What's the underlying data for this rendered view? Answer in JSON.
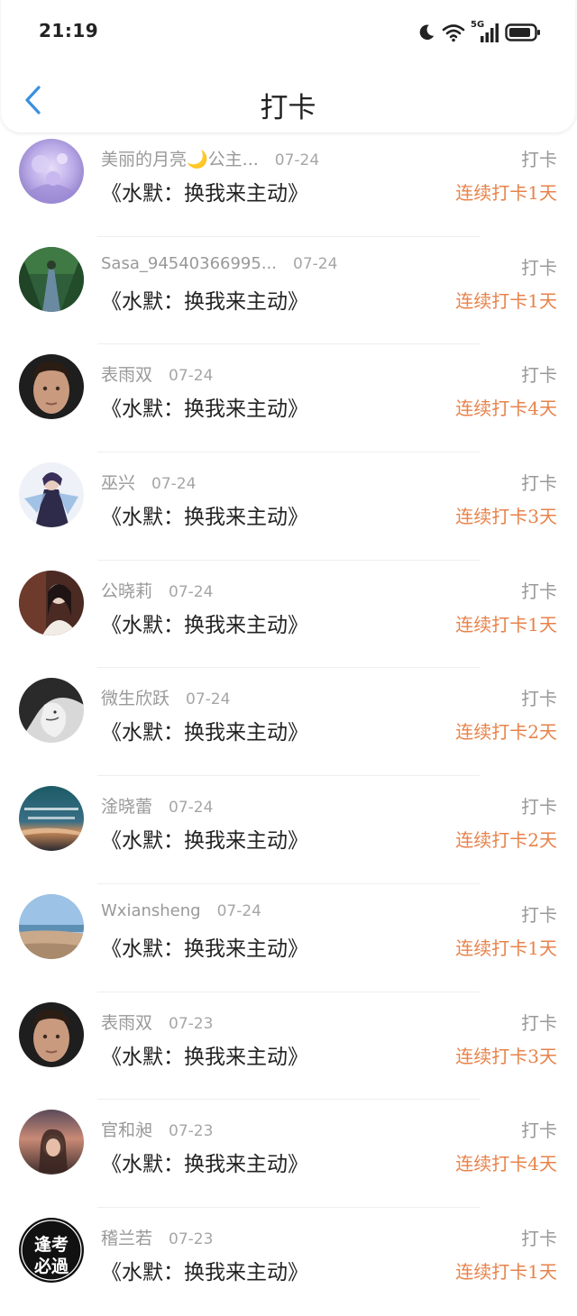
{
  "status_bar": {
    "time": "21:19",
    "network": "5G"
  },
  "header": {
    "title": "打卡"
  },
  "colors": {
    "accent_back": "#3a8fe0",
    "streak": "#e8824a",
    "muted": "#999999"
  },
  "items": [
    {
      "name": "美丽的月亮🌙公主...",
      "date": "07-24",
      "book": "《水默：换我来主动》",
      "tag": "打卡",
      "streak": "连续打卡1天"
    },
    {
      "name": "Sasa_94540366995...",
      "date": "07-24",
      "book": "《水默：换我来主动》",
      "tag": "打卡",
      "streak": "连续打卡1天"
    },
    {
      "name": "表雨双",
      "date": "07-24",
      "book": "《水默：换我来主动》",
      "tag": "打卡",
      "streak": "连续打卡4天"
    },
    {
      "name": "巫兴",
      "date": "07-24",
      "book": "《水默：换我来主动》",
      "tag": "打卡",
      "streak": "连续打卡3天"
    },
    {
      "name": "公晓莉",
      "date": "07-24",
      "book": "《水默：换我来主动》",
      "tag": "打卡",
      "streak": "连续打卡1天"
    },
    {
      "name": "微生欣跃",
      "date": "07-24",
      "book": "《水默：换我来主动》",
      "tag": "打卡",
      "streak": "连续打卡2天"
    },
    {
      "name": "淦晓蕾",
      "date": "07-24",
      "book": "《水默：换我来主动》",
      "tag": "打卡",
      "streak": "连续打卡2天"
    },
    {
      "name": "Wxiansheng",
      "date": "07-24",
      "book": "《水默：换我来主动》",
      "tag": "打卡",
      "streak": "连续打卡1天"
    },
    {
      "name": "表雨双",
      "date": "07-23",
      "book": "《水默：换我来主动》",
      "tag": "打卡",
      "streak": "连续打卡3天"
    },
    {
      "name": "官和昶",
      "date": "07-23",
      "book": "《水默：换我来主动》",
      "tag": "打卡",
      "streak": "连续打卡4天"
    },
    {
      "name": "稽兰若",
      "date": "07-23",
      "book": "《水默：换我来主动》",
      "tag": "打卡",
      "streak": "连续打卡1天"
    }
  ],
  "avatar_11_text": [
    "逢考",
    "必過"
  ]
}
